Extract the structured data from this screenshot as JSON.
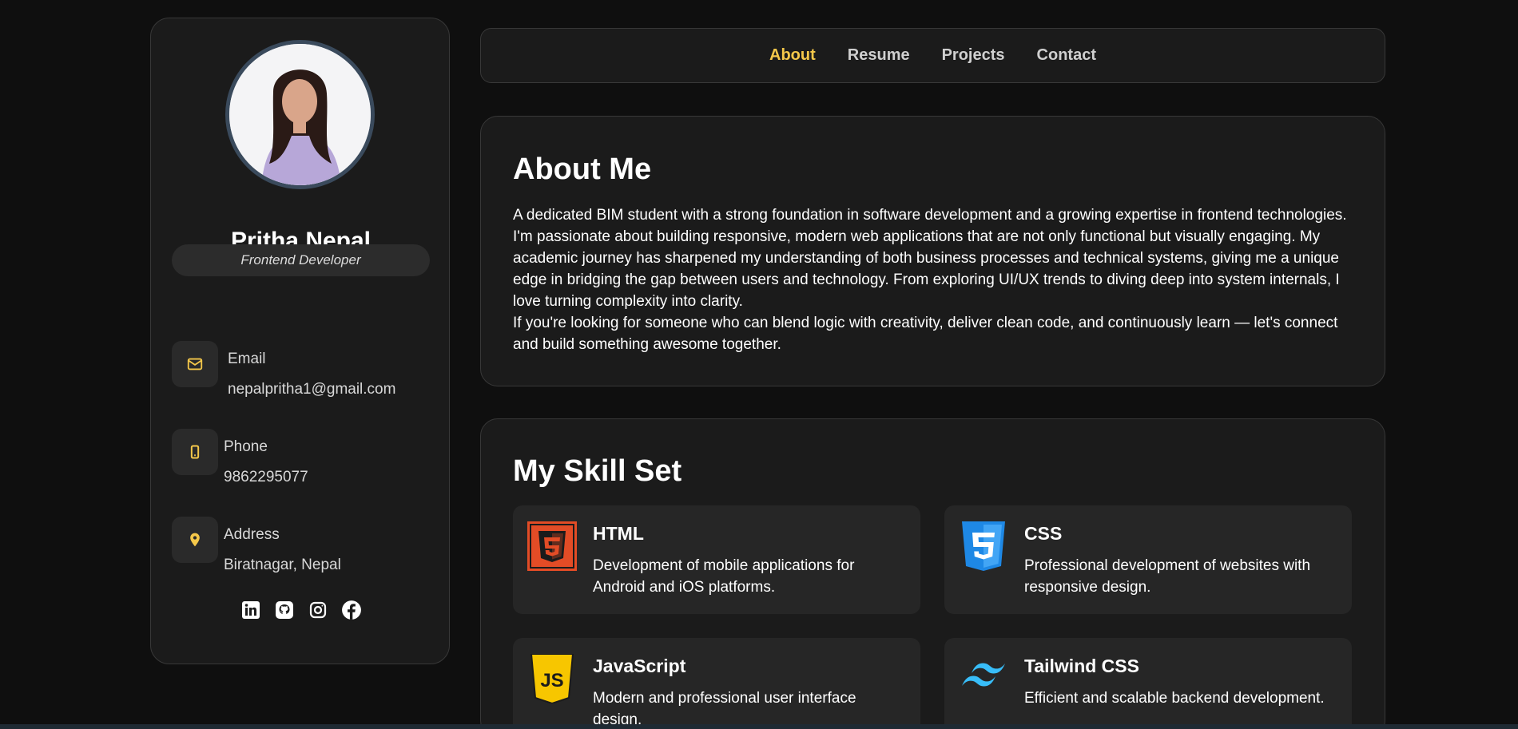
{
  "profile": {
    "name": "Pritha Nepal",
    "role": "Frontend Developer"
  },
  "contacts": {
    "email": {
      "label": "Email",
      "value": "nepalpritha1@gmail.com",
      "icon": "mail-icon"
    },
    "phone": {
      "label": "Phone",
      "value": "9862295077",
      "icon": "phone-icon"
    },
    "address": {
      "label": "Address",
      "value": "Biratnagar, Nepal",
      "icon": "location-icon"
    }
  },
  "socials": [
    "linkedin-icon",
    "github-icon",
    "instagram-icon",
    "facebook-icon"
  ],
  "nav": {
    "about": "About",
    "resume": "Resume",
    "projects": "Projects",
    "contact": "Contact",
    "active": "About"
  },
  "about": {
    "title": "About Me",
    "paragraph1": "A dedicated BIM student with a strong foundation in software development and a growing expertise in frontend technologies. I'm passionate about building responsive, modern web applications that are not only functional but visually engaging. My academic journey has sharpened my understanding of both business processes and technical systems, giving me a unique edge in bridging the gap between users and technology. From exploring UI/UX trends to diving deep into system internals, I love turning complexity into clarity.",
    "paragraph2": "If you're looking for someone who can blend logic with creativity, deliver clean code, and continuously learn — let's connect and build something awesome together."
  },
  "skills": {
    "title": "My Skill Set",
    "items": [
      {
        "name": "HTML",
        "description": "Development of mobile applications for Android and iOS platforms."
      },
      {
        "name": "CSS",
        "description": "Professional development of websites with responsive design."
      },
      {
        "name": "JavaScript",
        "description": "Modern and professional user interface design."
      },
      {
        "name": "Tailwind CSS",
        "description": "Efficient and scalable backend development."
      }
    ]
  },
  "colors": {
    "accent": "#f5c84a",
    "background": "#0f0f0f",
    "card": "#1b1b1b"
  }
}
